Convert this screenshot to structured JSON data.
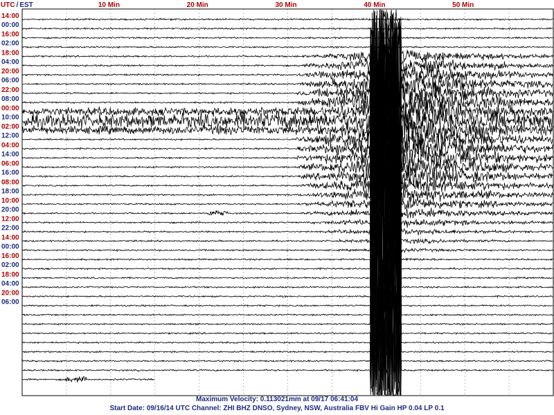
{
  "chart_data": {
    "type": "seismogram",
    "header": {
      "utc": "UTC",
      "sep": "/",
      "est": "EST"
    },
    "x_ticks": [
      {
        "min": 10,
        "label": "10 Min"
      },
      {
        "min": 20,
        "label": "20 Min"
      },
      {
        "min": 30,
        "label": "30 Min"
      },
      {
        "min": 40,
        "label": "40 Min"
      },
      {
        "min": 50,
        "label": "50 Min"
      }
    ],
    "x_range_min": [
      0,
      60
    ],
    "time_labels": [
      {
        "utc": "14:00",
        "est": "00:00"
      },
      {
        "utc": "16:00",
        "est": "02:00"
      },
      {
        "utc": "18:00",
        "est": "04:00"
      },
      {
        "utc": "20:00",
        "est": "06:00"
      },
      {
        "utc": "22:00",
        "est": "08:00"
      },
      {
        "utc": "00:00",
        "est": "10:00"
      },
      {
        "utc": "02:00",
        "est": "12:00"
      },
      {
        "utc": "04:00",
        "est": "14:00"
      },
      {
        "utc": "06:00",
        "est": "16:00"
      },
      {
        "utc": "08:00",
        "est": "18:00"
      },
      {
        "utc": "10:00",
        "est": "20:00"
      },
      {
        "utc": "12:00",
        "est": "22:00"
      },
      {
        "utc": "14:00",
        "est": "00:00"
      },
      {
        "utc": "16:00",
        "est": "02:00"
      },
      {
        "utc": "18:00",
        "est": "04:00"
      },
      {
        "utc": "20:00",
        "est": "06:00"
      }
    ],
    "trace_count": 40,
    "last_trace_end_min": 15,
    "events": [
      {
        "type": "noise_band",
        "trace_from": 10,
        "trace_to": 12,
        "start_min": 0,
        "end_min": 60
      },
      {
        "type": "small_burst",
        "trace": 21,
        "at_min": 22
      },
      {
        "type": "main_quake",
        "start_min": 31,
        "peak_min": 40.3,
        "end_min": 60
      },
      {
        "type": "small_burst",
        "trace": 39,
        "at_min": 6
      }
    ],
    "grid": true,
    "colors": {
      "utc": "#b00000",
      "est": "#1c2b80",
      "trace": "#000000",
      "grid": "#8a8a8a"
    }
  },
  "footer": {
    "line1": "Maximum Velocity: 0.113021mm at 09/17 06:41:04",
    "line2": "Start Date: 09/16/14 UTC Channel: ZHI  BHZ  DNSO, Sydney, NSW, Australia  FBV Hi Gain HP 0.04 LP 0.1"
  }
}
